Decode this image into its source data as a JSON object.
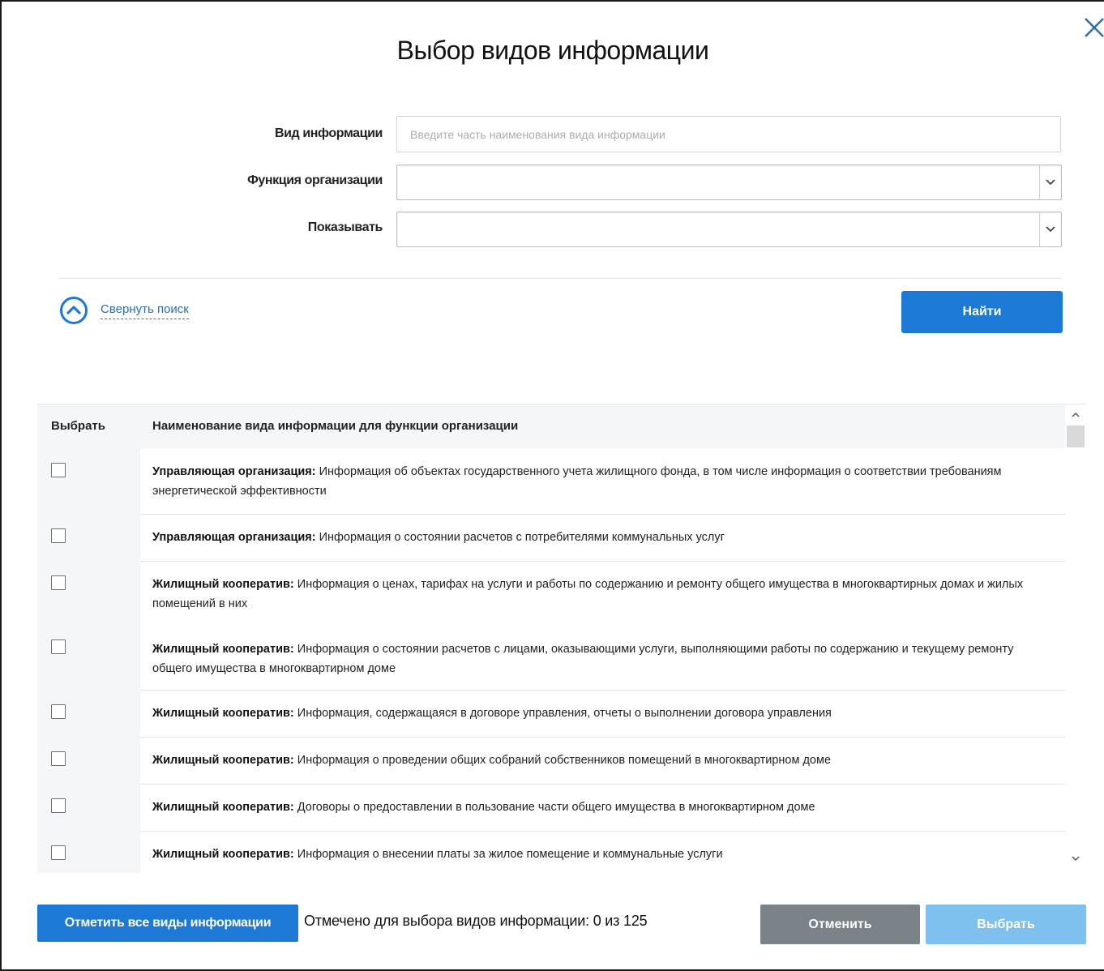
{
  "dialog": {
    "title": "Выбор видов информации"
  },
  "filters": {
    "info_type_label": "Вид информации",
    "info_type_placeholder": "Введите часть наименования вида информации",
    "info_type_value": "",
    "org_function_label": "Функция организации",
    "org_function_value": "",
    "show_label": "Показывать",
    "show_value": ""
  },
  "search": {
    "collapse_label": "Свернуть поиск",
    "find_label": "Найти"
  },
  "table": {
    "col_select": "Выбрать",
    "col_name": "Наименование вида информации для функции организации",
    "rows": [
      {
        "prefix": "Управляющая организация:",
        "text": "Информация об объектах государственного учета жилищного фонда, в том числе информация о соответствии требованиям энергетической эффективности",
        "checked": false
      },
      {
        "prefix": "Управляющая организация:",
        "text": "Информация о состоянии расчетов с потребителями коммунальных услуг",
        "checked": false
      },
      {
        "prefix": "Жилищный кооператив:",
        "text": "Информация о ценах, тарифах на услуги и работы по содержанию и ремонту общего имущества в многоквартирных домах и жилых помещений в них",
        "checked": false
      },
      {
        "prefix": "Жилищный кооператив:",
        "text": "Информация о состоянии расчетов с лицами, оказывающими услуги, выполняющими работы по содержанию и текущему ремонту общего имущества в многоквартирном доме",
        "checked": false
      },
      {
        "prefix": "Жилищный кооператив:",
        "text": "Информация, содержащаяся в договоре управления, отчеты о выполнении договора управления",
        "checked": false
      },
      {
        "prefix": "Жилищный кооператив:",
        "text": "Информация о проведении общих собраний собственников помещений в многоквартирном доме",
        "checked": false
      },
      {
        "prefix": "Жилищный кооператив:",
        "text": "Договоры о предоставлении в пользование части общего имущества в многоквартирном доме",
        "checked": false
      },
      {
        "prefix": "Жилищный кооператив:",
        "text": "Информация о внесении платы за жилое помещение и коммунальные услуги",
        "checked": false
      }
    ]
  },
  "footer": {
    "mark_all_label": "Отметить все виды информации",
    "counter_text": "Отмечено для выбора видов информации: 0 из 125",
    "cancel_label": "Отменить",
    "select_label": "Выбрать"
  },
  "colors": {
    "primary": "#1d79d6",
    "primary_disabled": "#7ec0ee",
    "secondary": "#7b8389",
    "link": "#2a6fb2"
  }
}
